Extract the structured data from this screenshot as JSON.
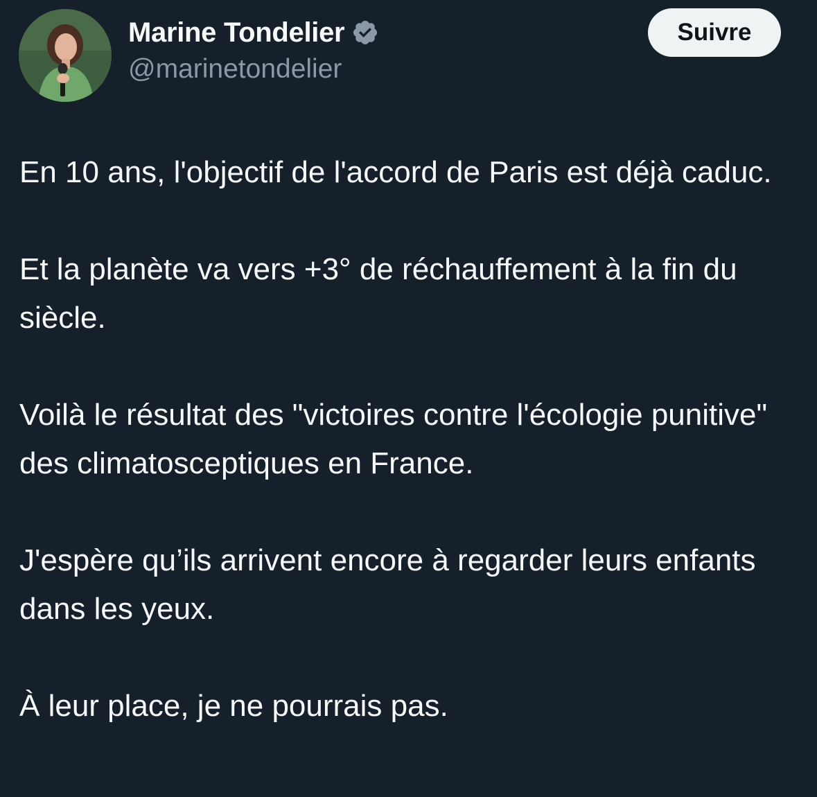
{
  "author": {
    "display_name": "Marine Tondelier",
    "handle": "@marinetondelier",
    "verified": true,
    "avatar_icon": "profile-photo"
  },
  "follow_button": {
    "label": "Suivre"
  },
  "tweet": {
    "paragraphs": [
      "En 10 ans, l'objectif de l'accord de Paris est déjà caduc.",
      "Et la planète va vers +3° de réchauffement à la fin du siècle.",
      "Voilà le résultat des \"victoires contre l'écologie punitive\" des climatosceptiques en France.",
      "J'espère qu’ils arrivent encore à regarder leurs enfants dans les yeux.",
      "À leur place, je ne pourrais pas."
    ]
  },
  "colors": {
    "background": "#15202b",
    "text_primary": "#f7f9f9",
    "text_secondary": "#8b98a5",
    "button_background": "#eff3f4",
    "verified_badge": "#8b98a5"
  }
}
